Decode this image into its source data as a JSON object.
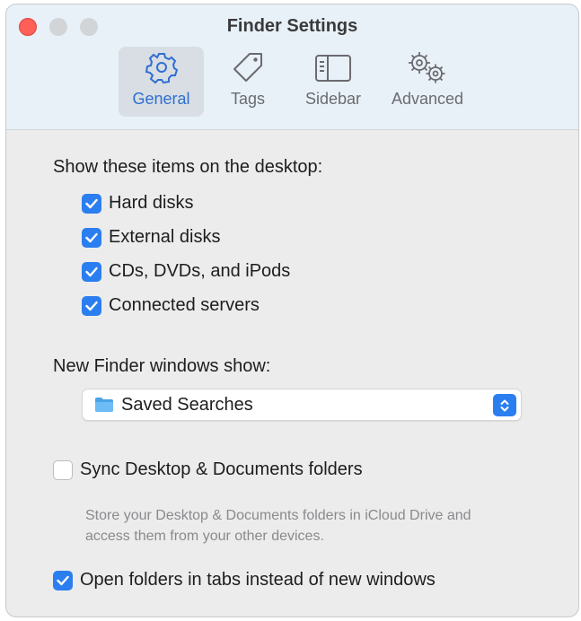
{
  "window": {
    "title": "Finder Settings"
  },
  "tabs": [
    {
      "label": "General",
      "icon": "gear-icon",
      "selected": true
    },
    {
      "label": "Tags",
      "icon": "tag-icon",
      "selected": false
    },
    {
      "label": "Sidebar",
      "icon": "sidebar-icon",
      "selected": false
    },
    {
      "label": "Advanced",
      "icon": "gears-icon",
      "selected": false
    }
  ],
  "desktop_items": {
    "heading": "Show these items on the desktop:",
    "options": [
      {
        "label": "Hard disks",
        "checked": true
      },
      {
        "label": "External disks",
        "checked": true
      },
      {
        "label": "CDs, DVDs, and iPods",
        "checked": true
      },
      {
        "label": "Connected servers",
        "checked": true
      }
    ]
  },
  "new_windows": {
    "heading": "New Finder windows show:",
    "selected": "Saved Searches",
    "icon": "folder-icon"
  },
  "sync": {
    "label": "Sync Desktop & Documents folders",
    "checked": false,
    "description": "Store your Desktop & Documents folders in iCloud Drive and access them from your other devices."
  },
  "open_in_tabs": {
    "label": "Open folders in tabs instead of new windows",
    "checked": true
  },
  "colors": {
    "accent": "#2b7ef0",
    "close": "#fe5f57",
    "toolbar": "#e8f1f8",
    "selected_tab_label": "#2f6fd1"
  }
}
